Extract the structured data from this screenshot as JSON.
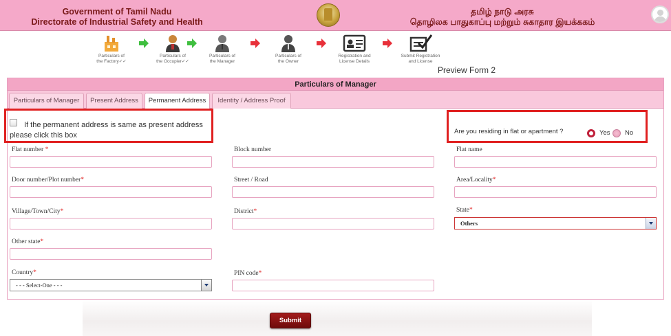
{
  "header": {
    "en_line1": "Government of Tamil Nadu",
    "en_line2": "Directorate of Industrial Safety and Health",
    "ta_line1": "தமிழ் நாடு அரசு",
    "ta_line2": "தொழிலக பாதுகாப்பு மற்றும் சுகாதார இயக்ககம்"
  },
  "steps": [
    {
      "label1": "Particulars of",
      "label2": "the Factory✓✓"
    },
    {
      "label1": "Particulars of",
      "label2": "the Occupier✓✓"
    },
    {
      "label1": "Particulars of",
      "label2": "the Manager"
    },
    {
      "label1": "Particulars of",
      "label2": "the Owner"
    },
    {
      "label1": "Registration and",
      "label2": "License Details"
    },
    {
      "label1": "Submit Registration",
      "label2": "and License"
    }
  ],
  "preview_label": "Preview Form 2",
  "panel_title": "Particulars of Manager",
  "tabs": [
    {
      "label": "Particulars of Manager"
    },
    {
      "label": "Present Address"
    },
    {
      "label": "Permanent Address"
    },
    {
      "label": "Identity / Address Proof"
    }
  ],
  "same_address_text": "If the permanent address is same as present address please click this box",
  "residing_question": "Are you residing in flat or apartment ?",
  "radio_yes": "Yes",
  "radio_no": "No",
  "fields": {
    "flat_number": "Flat number",
    "block_number": "Block number",
    "flat_name": "Flat name",
    "door_number": "Door number/Plot number",
    "street": "Street / Road",
    "area": "Area/Locality",
    "village": "Village/Town/City",
    "district": "District",
    "state": "State",
    "other_state": "Other state",
    "country": "Country",
    "pin_code": "PIN code"
  },
  "required_mark": "*",
  "state_value": "Others",
  "country_value": "- - - Select-One - - -",
  "submit_label": "Submit",
  "colors": {
    "header_bg": "#f5a9c9",
    "accent_red": "#e02020",
    "submit_bg": "#8b1212"
  }
}
